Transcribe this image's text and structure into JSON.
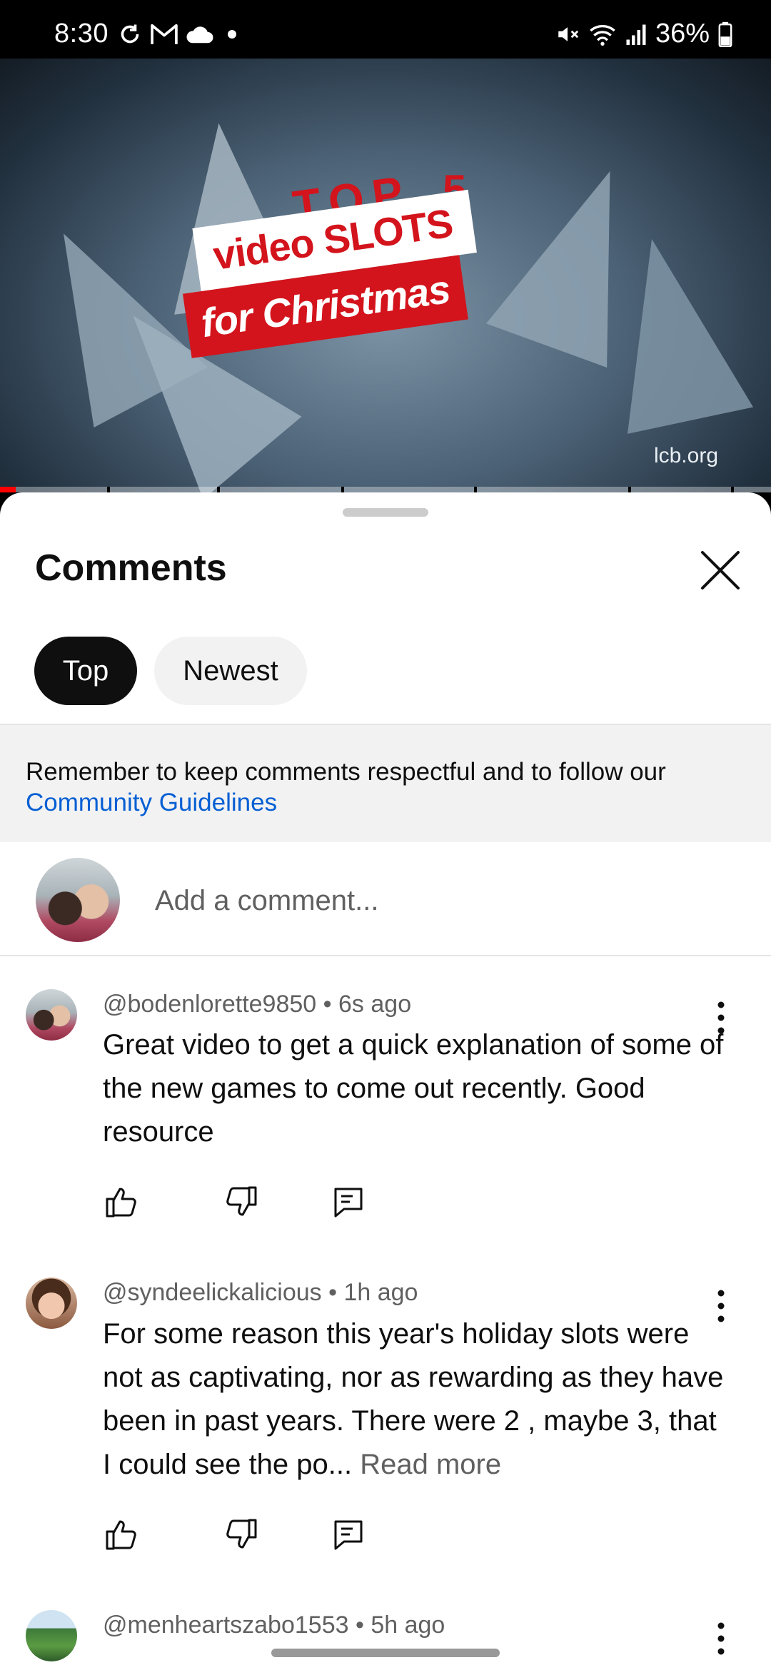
{
  "status_bar": {
    "time": "8:30",
    "battery": "36%",
    "left_icons": [
      "sync-icon",
      "gmail-icon",
      "cloud-icon",
      "dot-icon"
    ],
    "right_icons": [
      "mute-icon",
      "wifi-icon",
      "signal-icon",
      "battery-icon"
    ]
  },
  "video": {
    "title_line1": "video SLOTS",
    "title_line2": "for Christmas",
    "top_text": "TOP",
    "number": "5",
    "watermark": "lcb.org",
    "progress": 0.02,
    "accent_color": "#ff0000"
  },
  "comments_sheet": {
    "title": "Comments",
    "chips": [
      {
        "label": "Top",
        "active": true
      },
      {
        "label": "Newest",
        "active": false
      }
    ],
    "notice": {
      "text": "Remember to keep comments respectful and to follow our",
      "link": "Community Guidelines"
    },
    "add_comment_placeholder": "Add a comment...",
    "comments": [
      {
        "author": "@bodenlorette9850",
        "age": "6s ago",
        "text": "Great video to get a quick explanation of some of the new games to come out recently. Good resource",
        "read_more": ""
      },
      {
        "author": "@syndeelickalicious",
        "age": "1h ago",
        "text": "For some reason this year's holiday slots were not as captivating, nor as rewarding as they have been in past years. There were 2 , maybe 3, that I could see the po...",
        "read_more": "Read more"
      },
      {
        "author": "@menheartszabo1553",
        "age": "5h ago",
        "text": "",
        "read_more": ""
      }
    ]
  },
  "colors": {
    "link": "#065fd4",
    "chip_active_bg": "#0f0f0f",
    "chip_inactive_bg": "#f2f2f2",
    "notice_bg": "#f2f2f2",
    "secondary_text": "#606060"
  }
}
